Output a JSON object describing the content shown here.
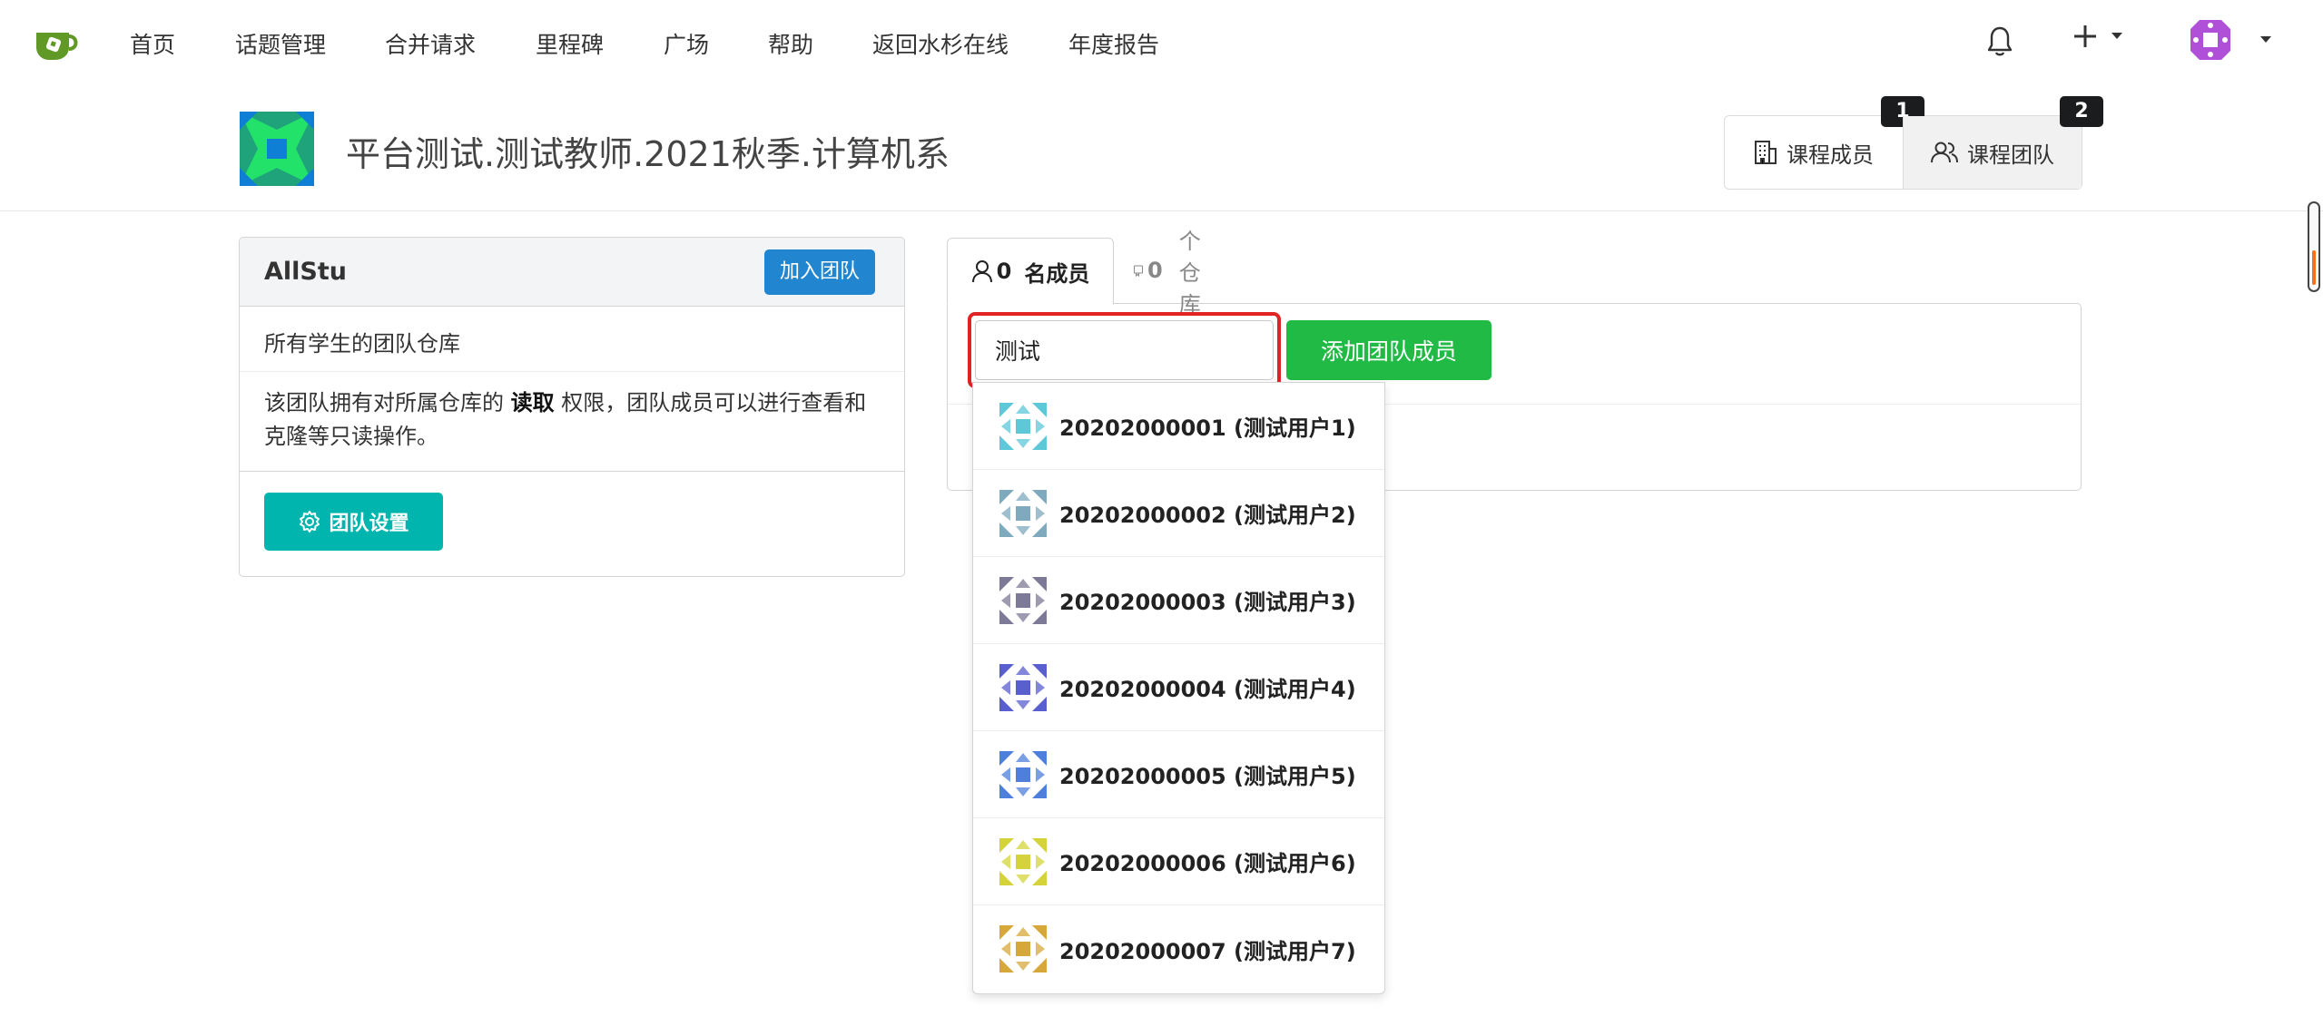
{
  "navbar": {
    "items": [
      "首页",
      "话题管理",
      "合并请求",
      "里程碑",
      "广场",
      "帮助",
      "返回水杉在线",
      "年度报告"
    ],
    "plus_label": "+"
  },
  "course": {
    "title": "平台测试.测试教师.2021秋季.计算机系"
  },
  "header_tabs": [
    {
      "label": "课程成员",
      "badge": "1",
      "icon": "building-icon"
    },
    {
      "label": "课程团队",
      "badge": "2",
      "icon": "users-icon"
    }
  ],
  "team": {
    "name": "AllStu",
    "join_label": "加入团队",
    "description": "所有学生的团队仓库",
    "permission_prefix": "该团队拥有对所属仓库的 ",
    "permission_bold": "读取",
    "permission_suffix": " 权限，团队成员可以进行查看和克隆等只读操作。",
    "settings_label": "团队设置"
  },
  "member_tabs": {
    "members_count": "0",
    "members_label": "名成员",
    "repos_count": "0",
    "repos_label": "个仓库"
  },
  "search": {
    "value": "测试",
    "add_label": "添加团队成员"
  },
  "suggestions": [
    {
      "label": "20202000001 (测试用户1)",
      "color": "#5cc8d8"
    },
    {
      "label": "20202000002 (测试用户2)",
      "color": "#7fa9bd"
    },
    {
      "label": "20202000003 (测试用户3)",
      "color": "#7d7a97"
    },
    {
      "label": "20202000004 (测试用户4)",
      "color": "#5a5fd0"
    },
    {
      "label": "20202000005 (测试用户5)",
      "color": "#4e7fdc"
    },
    {
      "label": "20202000006 (测试用户6)",
      "color": "#d4d43a"
    },
    {
      "label": "20202000007 (测试用户7)",
      "color": "#d6a83a"
    }
  ],
  "colors": {
    "accent_blue": "#2185d0",
    "teal": "#00b5ad",
    "green": "#21ba45",
    "highlight_red": "#e02424"
  }
}
